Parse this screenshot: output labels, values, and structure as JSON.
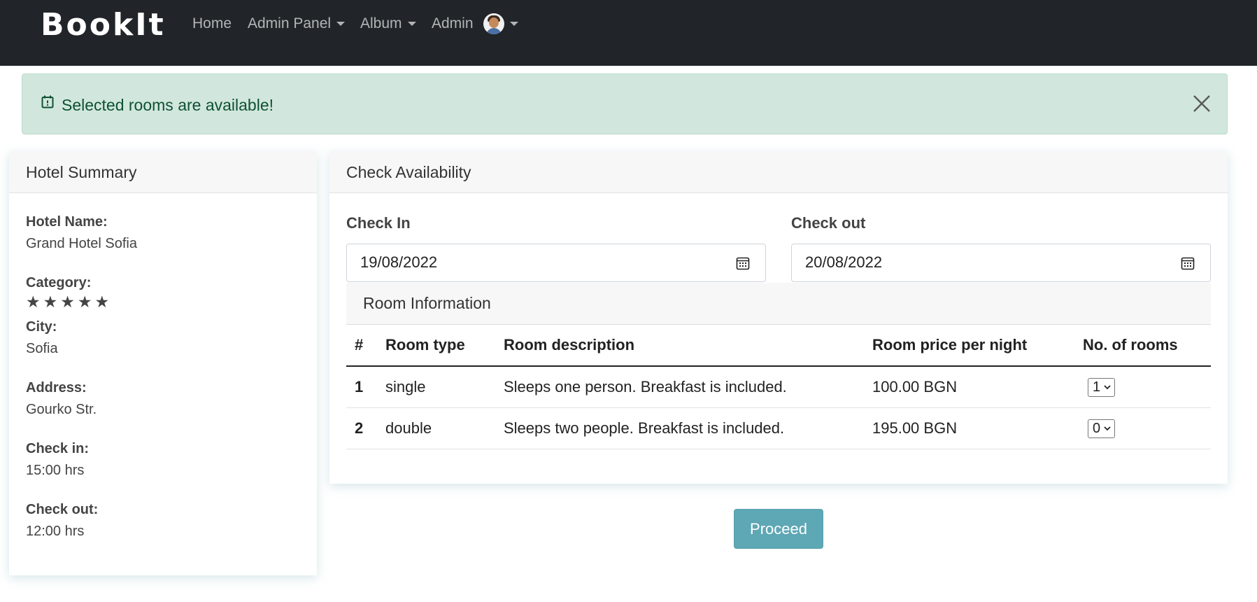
{
  "navbar": {
    "brand": "BookIt",
    "links": [
      {
        "label": "Home",
        "dropdown": false
      },
      {
        "label": "Admin Panel",
        "dropdown": true
      },
      {
        "label": "Album",
        "dropdown": true
      },
      {
        "label": "Admin",
        "dropdown": true
      }
    ],
    "avatar_icon": "user-avatar-icon"
  },
  "alert": {
    "icon": "calendar-check-icon",
    "message": "Selected rooms are available!",
    "close_icon": "close-icon",
    "color": "#0f5132",
    "background": "#d1e7dd"
  },
  "hotel_summary": {
    "title": "Hotel Summary",
    "name_label": "Hotel Name:",
    "name": "Grand Hotel Sofia",
    "category_label": "Category:",
    "stars": 5,
    "star_glyph": "★",
    "city_label": "City:",
    "city": "Sofia",
    "address_label": "Address:",
    "address": "Gourko Str.",
    "checkin_label": "Check in:",
    "checkin": "15:00 hrs",
    "checkout_label": "Check out:",
    "checkout": "12:00 hrs"
  },
  "availability": {
    "title": "Check Availability",
    "check_in_label": "Check In",
    "check_in_value": "19/08/2022",
    "check_out_label": "Check out",
    "check_out_value": "20/08/2022",
    "calendar_icon": "calendar-icon",
    "room_info_title": "Room Information",
    "table": {
      "headers": [
        "#",
        "Room type",
        "Room description",
        "Room price per night",
        "No. of rooms"
      ],
      "rows": [
        {
          "num": "1",
          "type": "single",
          "description": "Sleeps one person. Breakfast is included.",
          "price": "100.00 BGN",
          "qty": "1"
        },
        {
          "num": "2",
          "type": "double",
          "description": "Sleeps two people. Breakfast is included.",
          "price": "195.00 BGN",
          "qty": "0"
        }
      ]
    }
  },
  "proceed_label": "Proceed",
  "colors": {
    "navbar": "#212529",
    "accent_button": "#5ea7b4"
  }
}
